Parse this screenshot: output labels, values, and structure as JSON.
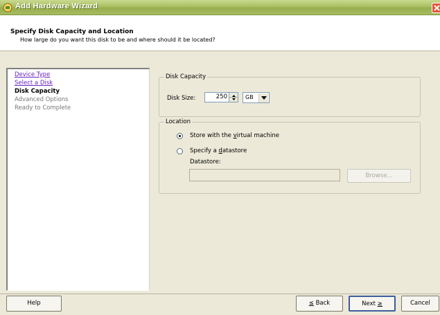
{
  "window": {
    "title": "Add Hardware Wizard"
  },
  "header": {
    "title": "Specify Disk Capacity and Location",
    "subtitle": "How large do you want this disk to be and where should it be located?"
  },
  "nav": {
    "items": [
      {
        "label": "Device Type",
        "state": "link"
      },
      {
        "label": "Select a Disk",
        "state": "link"
      },
      {
        "label": "Disk Capacity",
        "state": "current"
      },
      {
        "label": "Advanced Options",
        "state": "disabled"
      },
      {
        "label": "Ready to Complete",
        "state": "disabled"
      }
    ]
  },
  "capacity": {
    "group_label": "Disk Capacity",
    "size_label": "Disk Size:",
    "size_value": "250",
    "unit": "GB"
  },
  "location": {
    "group_label": "Location",
    "option1_pre": "Store with the ",
    "option1_key": "v",
    "option1_post": "irtual machine",
    "option2_pre": "Specify a ",
    "option2_key": "d",
    "option2_post": "atastore",
    "datastore_label": "Datastore:",
    "browse_label": "Browse..."
  },
  "buttons": {
    "help": "Help",
    "back_key": "≤",
    "back_post": " Back",
    "next_pre": "Next ",
    "next_key": "≥",
    "cancel": "Cancel"
  },
  "colors": {
    "title_bar": "#a9bf62",
    "link": "#6a24c4",
    "close": "#e5553a"
  },
  "icons": {
    "app": "wizard-app-icon",
    "close": "close-icon"
  }
}
